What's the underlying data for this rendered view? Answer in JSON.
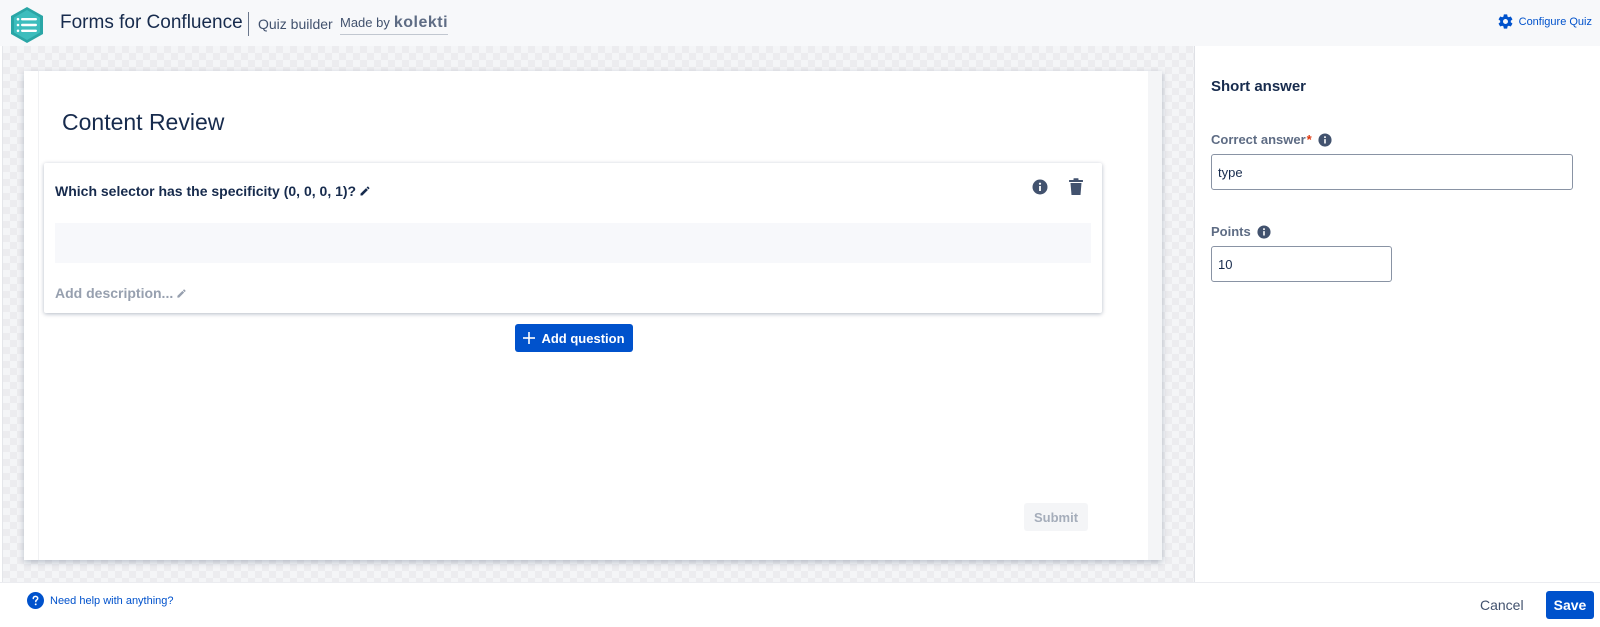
{
  "header": {
    "app_title": "Forms for Confluence",
    "quiz_builder": "Quiz builder",
    "made_by": "Made by",
    "brand": "kolekti",
    "configure_label": "Configure Quiz",
    "logo_icon": "stacked-lines-hexagon-icon",
    "configure_icon": "gear-icon"
  },
  "form": {
    "title": "Content Review",
    "question": {
      "text": "Which selector has the specificity (0, 0, 0, 1)?",
      "description_placeholder": "Add description...",
      "icons": [
        "pencil-icon",
        "info-icon",
        "trash-icon"
      ]
    },
    "add_question_label": "Add question",
    "submit_label": "Submit"
  },
  "panel": {
    "title": "Short answer",
    "correct_answer_label": "Correct answer",
    "required_marker": "*",
    "correct_answer_value": "type",
    "points_label": "Points",
    "points_value": "10"
  },
  "footer": {
    "help_text": "Need help with anything?",
    "cancel_label": "Cancel",
    "save_label": "Save"
  },
  "colors": {
    "primary": "#0052CC",
    "text": "#172B4D",
    "muted": "#97A0AF",
    "required": "#DE350B",
    "logo": "#2AA6A6"
  }
}
